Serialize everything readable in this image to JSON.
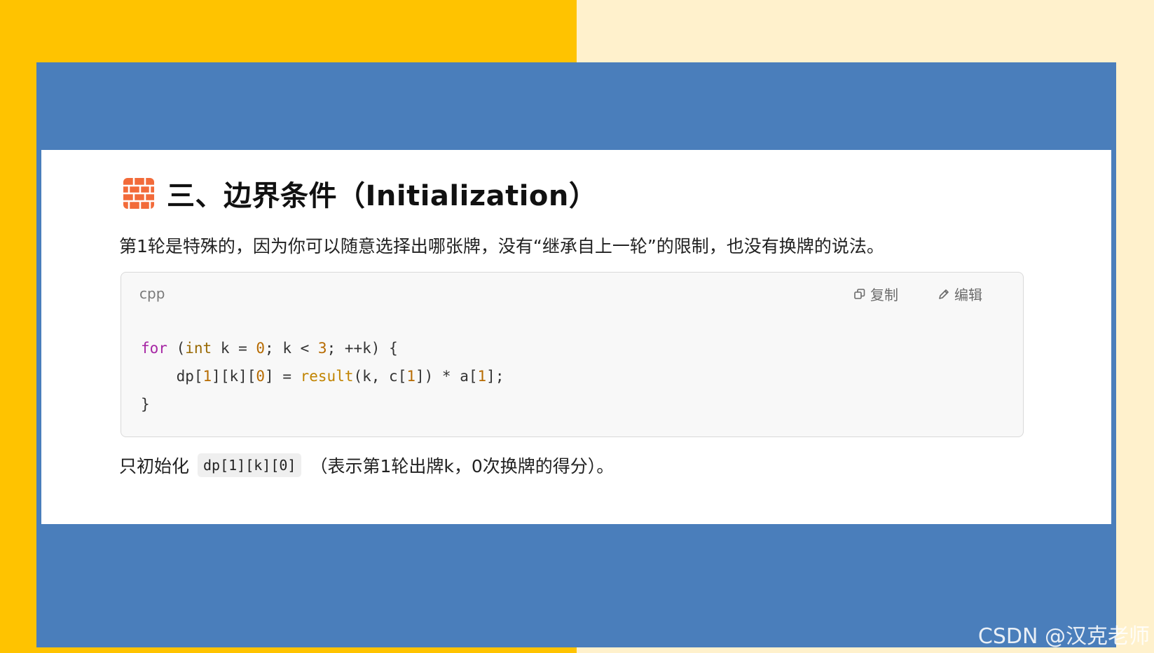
{
  "section": {
    "icon": "brick-icon",
    "title": "三、边界条件（Initialization）"
  },
  "intro": "第1轮是特殊的，因为你可以随意选择出哪张牌，没有“继承自上一轮”的限制，也没有换牌的说法。",
  "code_block": {
    "language": "cpp",
    "copy_label": "复制",
    "edit_label": "编辑",
    "lines": [
      [
        {
          "t": "for",
          "c": "kw"
        },
        {
          "t": " ("
        },
        {
          "t": "int",
          "c": "ty"
        },
        {
          "t": " k = "
        },
        {
          "t": "0",
          "c": "num"
        },
        {
          "t": "; k < "
        },
        {
          "t": "3",
          "c": "num"
        },
        {
          "t": "; ++k) {"
        }
      ],
      [
        {
          "t": "    dp["
        },
        {
          "t": "1",
          "c": "num"
        },
        {
          "t": "][k]["
        },
        {
          "t": "0",
          "c": "num"
        },
        {
          "t": "] = "
        },
        {
          "t": "result",
          "c": "fn"
        },
        {
          "t": "(k, c["
        },
        {
          "t": "1",
          "c": "num"
        },
        {
          "t": "]) * a["
        },
        {
          "t": "1",
          "c": "num"
        },
        {
          "t": "];"
        }
      ],
      [
        {
          "t": "}"
        }
      ]
    ]
  },
  "note": {
    "prefix": "只初始化",
    "inline_code": "dp[1][k][0]",
    "suffix": "（表示第1轮出牌k，0次换牌的得分）。"
  },
  "watermark": "CSDN @汉克老师",
  "colors": {
    "left_background": "#FFC300",
    "right_background": "#FFF1CC",
    "slide_frame": "#4A7EBB",
    "icon": "#F26B3A",
    "keyword": "#A626A4",
    "type": "#986801",
    "number": "#B76B01",
    "function": "#C18401"
  }
}
